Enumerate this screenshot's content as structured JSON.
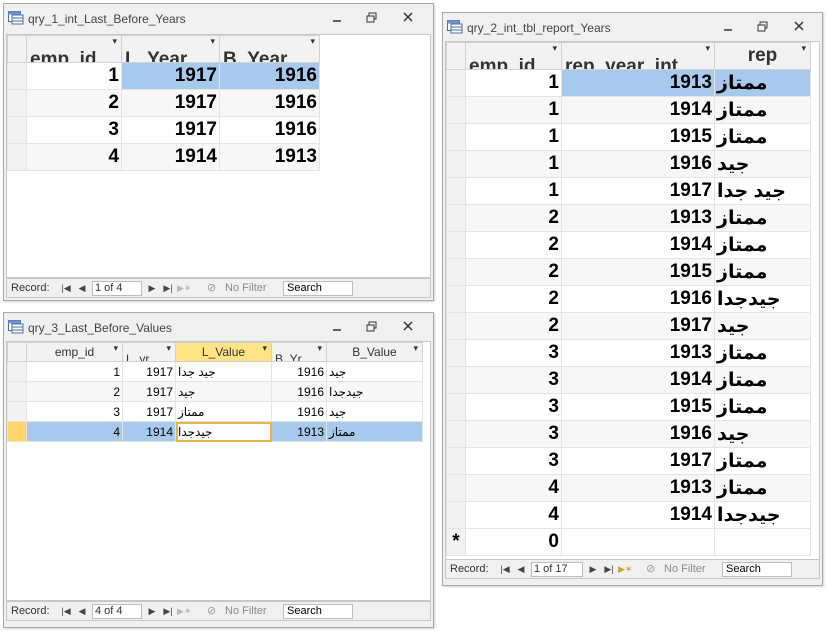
{
  "windows": {
    "q1": {
      "title": "qry_1_int_Last_Before_Years",
      "columns": [
        "emp_id",
        "L_Year",
        "B_Year"
      ],
      "rows": [
        [
          "1",
          "1917",
          "1916"
        ],
        [
          "2",
          "1917",
          "1916"
        ],
        [
          "3",
          "1917",
          "1916"
        ],
        [
          "4",
          "1914",
          "1913"
        ]
      ],
      "nav": {
        "record_label": "Record:",
        "position": "1 of 4",
        "filter": "No Filter",
        "search": "Search"
      }
    },
    "q2": {
      "title": "qry_2_int_tbl_report_Years",
      "columns": [
        "emp_id",
        "rep_year_int",
        "rep"
      ],
      "rows": [
        [
          "1",
          "1913",
          "ممتاز"
        ],
        [
          "1",
          "1914",
          "ممتاز"
        ],
        [
          "1",
          "1915",
          "ممتاز"
        ],
        [
          "1",
          "1916",
          "جيد"
        ],
        [
          "1",
          "1917",
          "جيد جدا"
        ],
        [
          "2",
          "1913",
          "ممتاز"
        ],
        [
          "2",
          "1914",
          "ممتاز"
        ],
        [
          "2",
          "1915",
          "ممتاز"
        ],
        [
          "2",
          "1916",
          "جيدجدا"
        ],
        [
          "2",
          "1917",
          "جيد"
        ],
        [
          "3",
          "1913",
          "ممتاز"
        ],
        [
          "3",
          "1914",
          "ممتاز"
        ],
        [
          "3",
          "1915",
          "ممتاز"
        ],
        [
          "3",
          "1916",
          "جيد"
        ],
        [
          "3",
          "1917",
          "ممتاز"
        ],
        [
          "4",
          "1913",
          "ممتاز"
        ],
        [
          "4",
          "1914",
          "جيدجدا"
        ]
      ],
      "new_row": {
        "marker": "*",
        "emp_id": "0"
      },
      "nav": {
        "record_label": "Record:",
        "position": "1 of 17",
        "filter": "No Filter",
        "search": "Search"
      }
    },
    "q3": {
      "title": "qry_3_Last_Before_Values",
      "columns": [
        "emp_id",
        "L_yr",
        "L_Value",
        "B_Yr",
        "B_Value"
      ],
      "rows": [
        [
          "1",
          "1917",
          "جيد جدا",
          "1916",
          "جيد"
        ],
        [
          "2",
          "1917",
          "جيد",
          "1916",
          "جيدجدا"
        ],
        [
          "3",
          "1917",
          "ممتاز",
          "1916",
          "جيد"
        ],
        [
          "4",
          "1914",
          "جيدجدا",
          "1913",
          "ممتاز"
        ]
      ],
      "nav": {
        "record_label": "Record:",
        "position": "4 of 4",
        "filter": "No Filter",
        "search": "Search"
      }
    }
  },
  "icons": {
    "window": "query-icon",
    "minimize": "minimize-icon",
    "restore": "restore-icon",
    "close": "close-icon",
    "first": "first-record-icon",
    "prev": "prev-record-icon",
    "next": "next-record-icon",
    "last": "last-record-icon",
    "new": "new-record-icon",
    "filter": "filter-icon",
    "dropdown": "dropdown-arrow-icon"
  },
  "colors": {
    "selection": "#a6c9ec",
    "active_header": "#ffe486",
    "current_selector": "#ffd66b"
  }
}
